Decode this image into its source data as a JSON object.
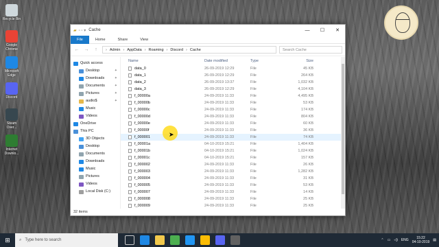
{
  "desktop": {
    "icons": [
      {
        "label": "Recycle Bin",
        "color": "#cfd8dc"
      },
      {
        "label": "Google Chrome",
        "color": "#ea4335"
      },
      {
        "label": "Microsoft Edge",
        "color": "#1e88e5"
      },
      {
        "label": "Discord",
        "color": "#5865f2"
      },
      {
        "label": "Steam Over...",
        "color": "#37474f"
      },
      {
        "label": "Internet Downlo...",
        "color": "#2e7d32"
      }
    ]
  },
  "window": {
    "title": "Cache",
    "controls": {
      "minimize": "—",
      "maximize": "☐",
      "close": "✕"
    },
    "ribbon_tabs": [
      "File",
      "Home",
      "Share",
      "View"
    ],
    "breadcrumb": [
      "Admin",
      "AppData",
      "Roaming",
      "Discord",
      "Cache"
    ],
    "search_placeholder": "Search Cache",
    "columns": {
      "name": "Name",
      "date": "Date modified",
      "type": "Type",
      "size": "Size"
    },
    "nav_pane": [
      {
        "label": "Quick access",
        "level": 0,
        "color": "#1e88e5"
      },
      {
        "label": "Desktop",
        "level": 1,
        "color": "#4a90d9",
        "pinned": true
      },
      {
        "label": "Downloads",
        "level": 1,
        "color": "#1e88e5",
        "pinned": true
      },
      {
        "label": "Documents",
        "level": 1,
        "color": "#90a4ae",
        "pinned": true
      },
      {
        "label": "Pictures",
        "level": 1,
        "color": "#90a4ae",
        "pinned": true
      },
      {
        "label": "audio$",
        "level": 1,
        "color": "#e6b84a",
        "pinned": true
      },
      {
        "label": "Music",
        "level": 1,
        "color": "#1e88e5"
      },
      {
        "label": "Videos",
        "level": 1,
        "color": "#7e57c2"
      },
      {
        "label": "OneDrive",
        "level": 0,
        "color": "#1e88e5"
      },
      {
        "label": "This PC",
        "level": 0,
        "color": "#4a90d9"
      },
      {
        "label": "3D Objects",
        "level": 1,
        "color": "#42a5f5"
      },
      {
        "label": "Desktop",
        "level": 1,
        "color": "#4a90d9"
      },
      {
        "label": "Documents",
        "level": 1,
        "color": "#90a4ae"
      },
      {
        "label": "Downloads",
        "level": 1,
        "color": "#1e88e5"
      },
      {
        "label": "Music",
        "level": 1,
        "color": "#1e88e5"
      },
      {
        "label": "Pictures",
        "level": 1,
        "color": "#90a4ae"
      },
      {
        "label": "Videos",
        "level": 1,
        "color": "#7e57c2"
      },
      {
        "label": "Local Disk (C:)",
        "level": 1,
        "color": "#9e9e9e"
      }
    ],
    "files": [
      {
        "name": "data_0",
        "date": "26-09-2019 12:29",
        "type": "File",
        "size": "45 KB"
      },
      {
        "name": "data_1",
        "date": "26-09-2019 12:29",
        "type": "File",
        "size": "264 KB"
      },
      {
        "name": "data_2",
        "date": "26-09-2019 13:37",
        "type": "File",
        "size": "1,032 KB"
      },
      {
        "name": "data_3",
        "date": "26-09-2019 12:29",
        "type": "File",
        "size": "4,104 KB"
      },
      {
        "name": "f_00000a",
        "date": "24-09-2019 11:33",
        "type": "File",
        "size": "4,495 KB"
      },
      {
        "name": "f_00000b",
        "date": "24-09-2019 11:33",
        "type": "File",
        "size": "53 KB"
      },
      {
        "name": "f_00000c",
        "date": "24-09-2019 11:33",
        "type": "File",
        "size": "174 KB"
      },
      {
        "name": "f_00000d",
        "date": "24-09-2019 11:33",
        "type": "File",
        "size": "804 KB"
      },
      {
        "name": "f_00000e",
        "date": "24-09-2019 11:33",
        "type": "File",
        "size": "60 KB"
      },
      {
        "name": "f_00000f",
        "date": "24-09-2019 11:33",
        "type": "File",
        "size": "36 KB"
      },
      {
        "name": "f_000001",
        "date": "24-09-2019 11:33",
        "type": "File",
        "size": "74 KB"
      },
      {
        "name": "f_00001a",
        "date": "04-10-2019 15:21",
        "type": "File",
        "size": "1,404 KB"
      },
      {
        "name": "f_00001b",
        "date": "04-10-2019 15:21",
        "type": "File",
        "size": "1,024 KB"
      },
      {
        "name": "f_00001c",
        "date": "04-10-2019 15:21",
        "type": "File",
        "size": "157 KB"
      },
      {
        "name": "f_000002",
        "date": "24-09-2019 11:33",
        "type": "File",
        "size": "26 KB"
      },
      {
        "name": "f_000003",
        "date": "24-09-2019 11:33",
        "type": "File",
        "size": "1,282 KB"
      },
      {
        "name": "f_000004",
        "date": "24-09-2019 11:33",
        "type": "File",
        "size": "31 KB"
      },
      {
        "name": "f_000005",
        "date": "24-09-2019 11:33",
        "type": "File",
        "size": "53 KB"
      },
      {
        "name": "f_000007",
        "date": "24-09-2019 11:33",
        "type": "File",
        "size": "14 KB"
      },
      {
        "name": "f_000008",
        "date": "24-09-2019 11:33",
        "type": "File",
        "size": "25 KB"
      },
      {
        "name": "f_000009",
        "date": "24-09-2019 11:33",
        "type": "File",
        "size": "25 KB"
      }
    ],
    "highlighted_file": "f_000001",
    "status": "32 items"
  },
  "taskbar": {
    "search_placeholder": "Type here to search",
    "language": "ENG",
    "time": "15:22",
    "date": "04-10-2019"
  },
  "colors": {
    "accent": "#1979ca",
    "taskbar": "#1f2a36",
    "highlight": "#e5f3ff"
  }
}
